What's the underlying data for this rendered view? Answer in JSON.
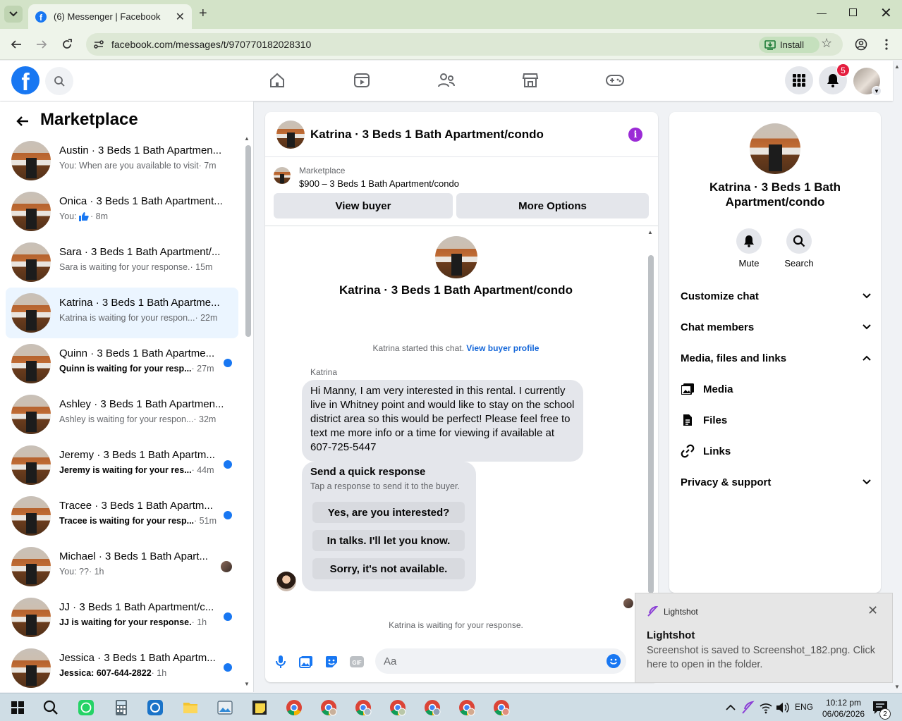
{
  "browser": {
    "tab_title": "(6) Messenger | Facebook",
    "url": "facebook.com/messages/t/970770182028310",
    "install_label": "Install"
  },
  "header": {
    "notification_count": "5"
  },
  "sidebar": {
    "title": "Marketplace",
    "conversations": [
      {
        "name": "Austin · 3 Beds 1 Bath Apartmen...",
        "preview": "You: When are you available to visit",
        "time": "· 7m",
        "unread": false
      },
      {
        "name": "Onica · 3 Beds 1 Bath Apartment...",
        "preview": "You: ",
        "time": "· 8m",
        "unread": false
      },
      {
        "name": "Sara · 3 Beds 1 Bath Apartment/...",
        "preview": "Sara is waiting for your response.",
        "time": "· 15m",
        "unread": false
      },
      {
        "name": "Katrina · 3 Beds 1 Bath Apartme...",
        "preview": "Katrina is waiting for your respon...",
        "time": "· 22m",
        "unread": false
      },
      {
        "name": "Quinn · 3 Beds 1 Bath Apartme...",
        "preview": "Quinn is waiting for your resp...",
        "time": "· 27m",
        "unread": true
      },
      {
        "name": "Ashley · 3 Beds 1 Bath Apartmen...",
        "preview": "Ashley is waiting for your respon...",
        "time": "· 32m",
        "unread": false
      },
      {
        "name": "Jeremy · 3 Beds 1 Bath Apartm...",
        "preview": "Jeremy is waiting for your res...",
        "time": "· 44m",
        "unread": true
      },
      {
        "name": "Tracee · 3 Beds 1 Bath Apartm...",
        "preview": "Tracee is waiting for your resp...",
        "time": "· 51m",
        "unread": true
      },
      {
        "name": "Michael · 3 Beds 1 Bath Apart...",
        "preview": "You: ??",
        "time": "· 1h",
        "unread": false
      },
      {
        "name": "JJ · 3 Beds 1 Bath Apartment/c...",
        "preview": "JJ is waiting for your response.",
        "time": "· 1h",
        "unread": true
      },
      {
        "name": "Jessica · 3 Beds 1 Bath Apartm...",
        "preview": "Jessica: 607-644-2822",
        "time": "· 1h",
        "unread": true
      }
    ]
  },
  "chat": {
    "title": "Katrina · 3 Beds 1 Bath Apartment/condo",
    "listing_source": "Marketplace",
    "listing_detail": "$900 – 3 Beds 1 Bath Apartment/condo",
    "view_buyer_label": "View buyer",
    "more_options_label": "More Options",
    "intro_title": "Katrina · 3 Beds 1 Bath Apartment/condo",
    "started_text": "Katrina started this chat.",
    "buyer_profile_link": "View buyer profile",
    "sender": "Katrina",
    "message": "Hi Manny, I am very interested in this rental. I currently live in Whitney point and would like to stay on the school district area so this would be perfect! Please feel free to text me more info or a time for viewing if available at 607-725-5447",
    "quick_title": "Send a quick response",
    "quick_subtitle": "Tap a response to send it to the buyer.",
    "quick_responses": [
      "Yes, are you interested?",
      "In talks. I'll let you know.",
      "Sorry, it's not available."
    ],
    "waiting_text": "Katrina is waiting for your response.",
    "input_placeholder": "Aa"
  },
  "details": {
    "title": "Katrina · 3 Beds 1 Bath Apartment/condo",
    "mute_label": "Mute",
    "search_label": "Search",
    "customize_label": "Customize chat",
    "members_label": "Chat members",
    "media_section_label": "Media, files and links",
    "media_label": "Media",
    "files_label": "Files",
    "links_label": "Links",
    "privacy_label": "Privacy & support"
  },
  "toast": {
    "app": "Lightshot",
    "heading": "Lightshot",
    "body": "Screenshot is saved to Screenshot_182.png. Click here to open in the folder."
  },
  "taskbar": {
    "language": "ENG",
    "time": "10:12 pm",
    "date": "06/06/2026",
    "notification_count": "2"
  },
  "colors": {
    "fb_blue": "#1877f2",
    "unread_dot": "#1877f2",
    "info_purple": "#9b2bd6",
    "badge_red": "#e41e3f"
  }
}
